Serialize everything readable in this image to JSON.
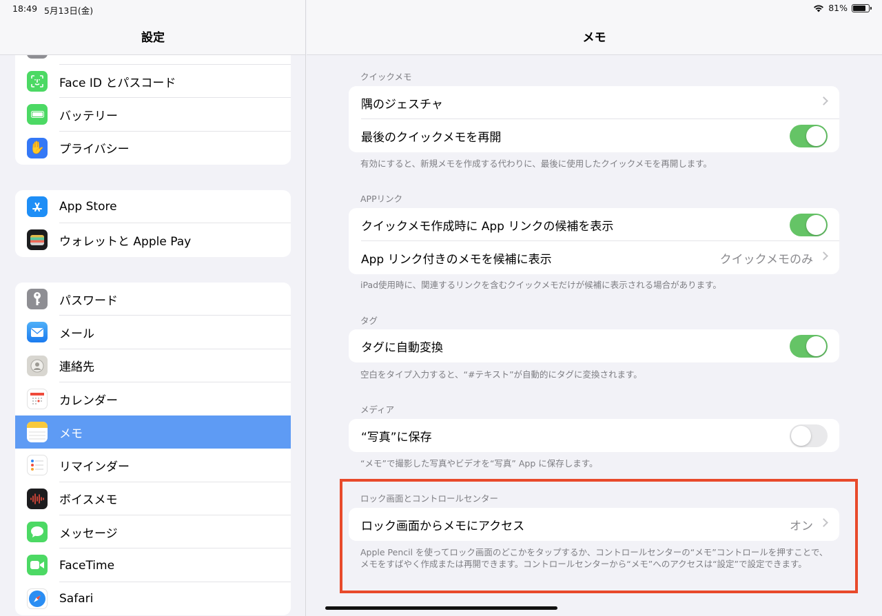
{
  "status": {
    "time": "18:49",
    "date": "5月13日(金)",
    "battery_pct": "81%",
    "battery_level": 0.81
  },
  "sidebar": {
    "title": "設定",
    "group1": [
      {
        "label": "Face ID とパスコード",
        "icon": "face-id-icon",
        "color": "#4cd964"
      },
      {
        "label": "バッテリー",
        "icon": "battery-icon",
        "color": "#4cd964"
      },
      {
        "label": "プライバシー",
        "icon": "hand-icon",
        "color": "#3478f6"
      }
    ],
    "group2": [
      {
        "label": "App Store",
        "icon": "app-store-icon",
        "color": "#1e8ef6"
      },
      {
        "label": "ウォレットと Apple Pay",
        "icon": "wallet-icon",
        "color": "#1c1c1e"
      }
    ],
    "group3": [
      {
        "label": "パスワード",
        "icon": "key-icon",
        "color": "#8e8e93"
      },
      {
        "label": "メール",
        "icon": "mail-icon",
        "color": "#2e8cf2"
      },
      {
        "label": "連絡先",
        "icon": "contacts-icon",
        "color": "#c8c7c2"
      },
      {
        "label": "カレンダー",
        "icon": "calendar-icon",
        "color": "#ffffff"
      },
      {
        "label": "メモ",
        "icon": "notes-icon",
        "color": "#ffffff",
        "selected": true
      },
      {
        "label": "リマインダー",
        "icon": "reminders-icon",
        "color": "#ffffff"
      },
      {
        "label": "ボイスメモ",
        "icon": "voice-memo-icon",
        "color": "#1c1c1e"
      },
      {
        "label": "メッセージ",
        "icon": "messages-icon",
        "color": "#4cd964"
      },
      {
        "label": "FaceTime",
        "icon": "facetime-icon",
        "color": "#4cd964"
      },
      {
        "label": "Safari",
        "icon": "safari-icon",
        "color": "#ffffff"
      }
    ]
  },
  "main": {
    "title": "メモ",
    "quick_note": {
      "header": "クイックメモ",
      "corner_gesture": "隅のジェスチャ",
      "resume_last": "最後のクイックメモを再開",
      "resume_last_on": true,
      "footer": "有効にすると、新規メモを作成する代わりに、最後に使用したクイックメモを再開します。"
    },
    "app_links": {
      "header": "APPリンク",
      "suggest_links": "クイックメモ作成時に App リンクの候補を表示",
      "suggest_links_on": true,
      "show_notes": "App リンク付きのメモを候補に表示",
      "show_notes_value": "クイックメモのみ",
      "footer": "iPad使用時に、関連するリンクを含むクイックメモだけが候補に表示される場合があります。"
    },
    "tags": {
      "header": "タグ",
      "auto_convert": "タグに自動変換",
      "auto_convert_on": true,
      "footer": "空白をタイプ入力すると、“#テキスト”が自動的にタグに変換されます。"
    },
    "media": {
      "header": "メディア",
      "save_photos": "“写真”に保存",
      "save_photos_on": false,
      "footer": "“メモ”で撮影した写真やビデオを“写真” App に保存します。"
    },
    "lock_screen": {
      "header": "ロック画面とコントロールセンター",
      "access": "ロック画面からメモにアクセス",
      "access_value": "オン",
      "footer": "Apple Pencil を使ってロック画面のどこかをタップするか、コントロールセンターの“メモ”コントロールを押すことで、メモをすばやく作成または再開できます。コントロールセンターから“メモ”へのアクセスは“設定”で設定できます。"
    },
    "highlight_color": "#e84a2b"
  }
}
